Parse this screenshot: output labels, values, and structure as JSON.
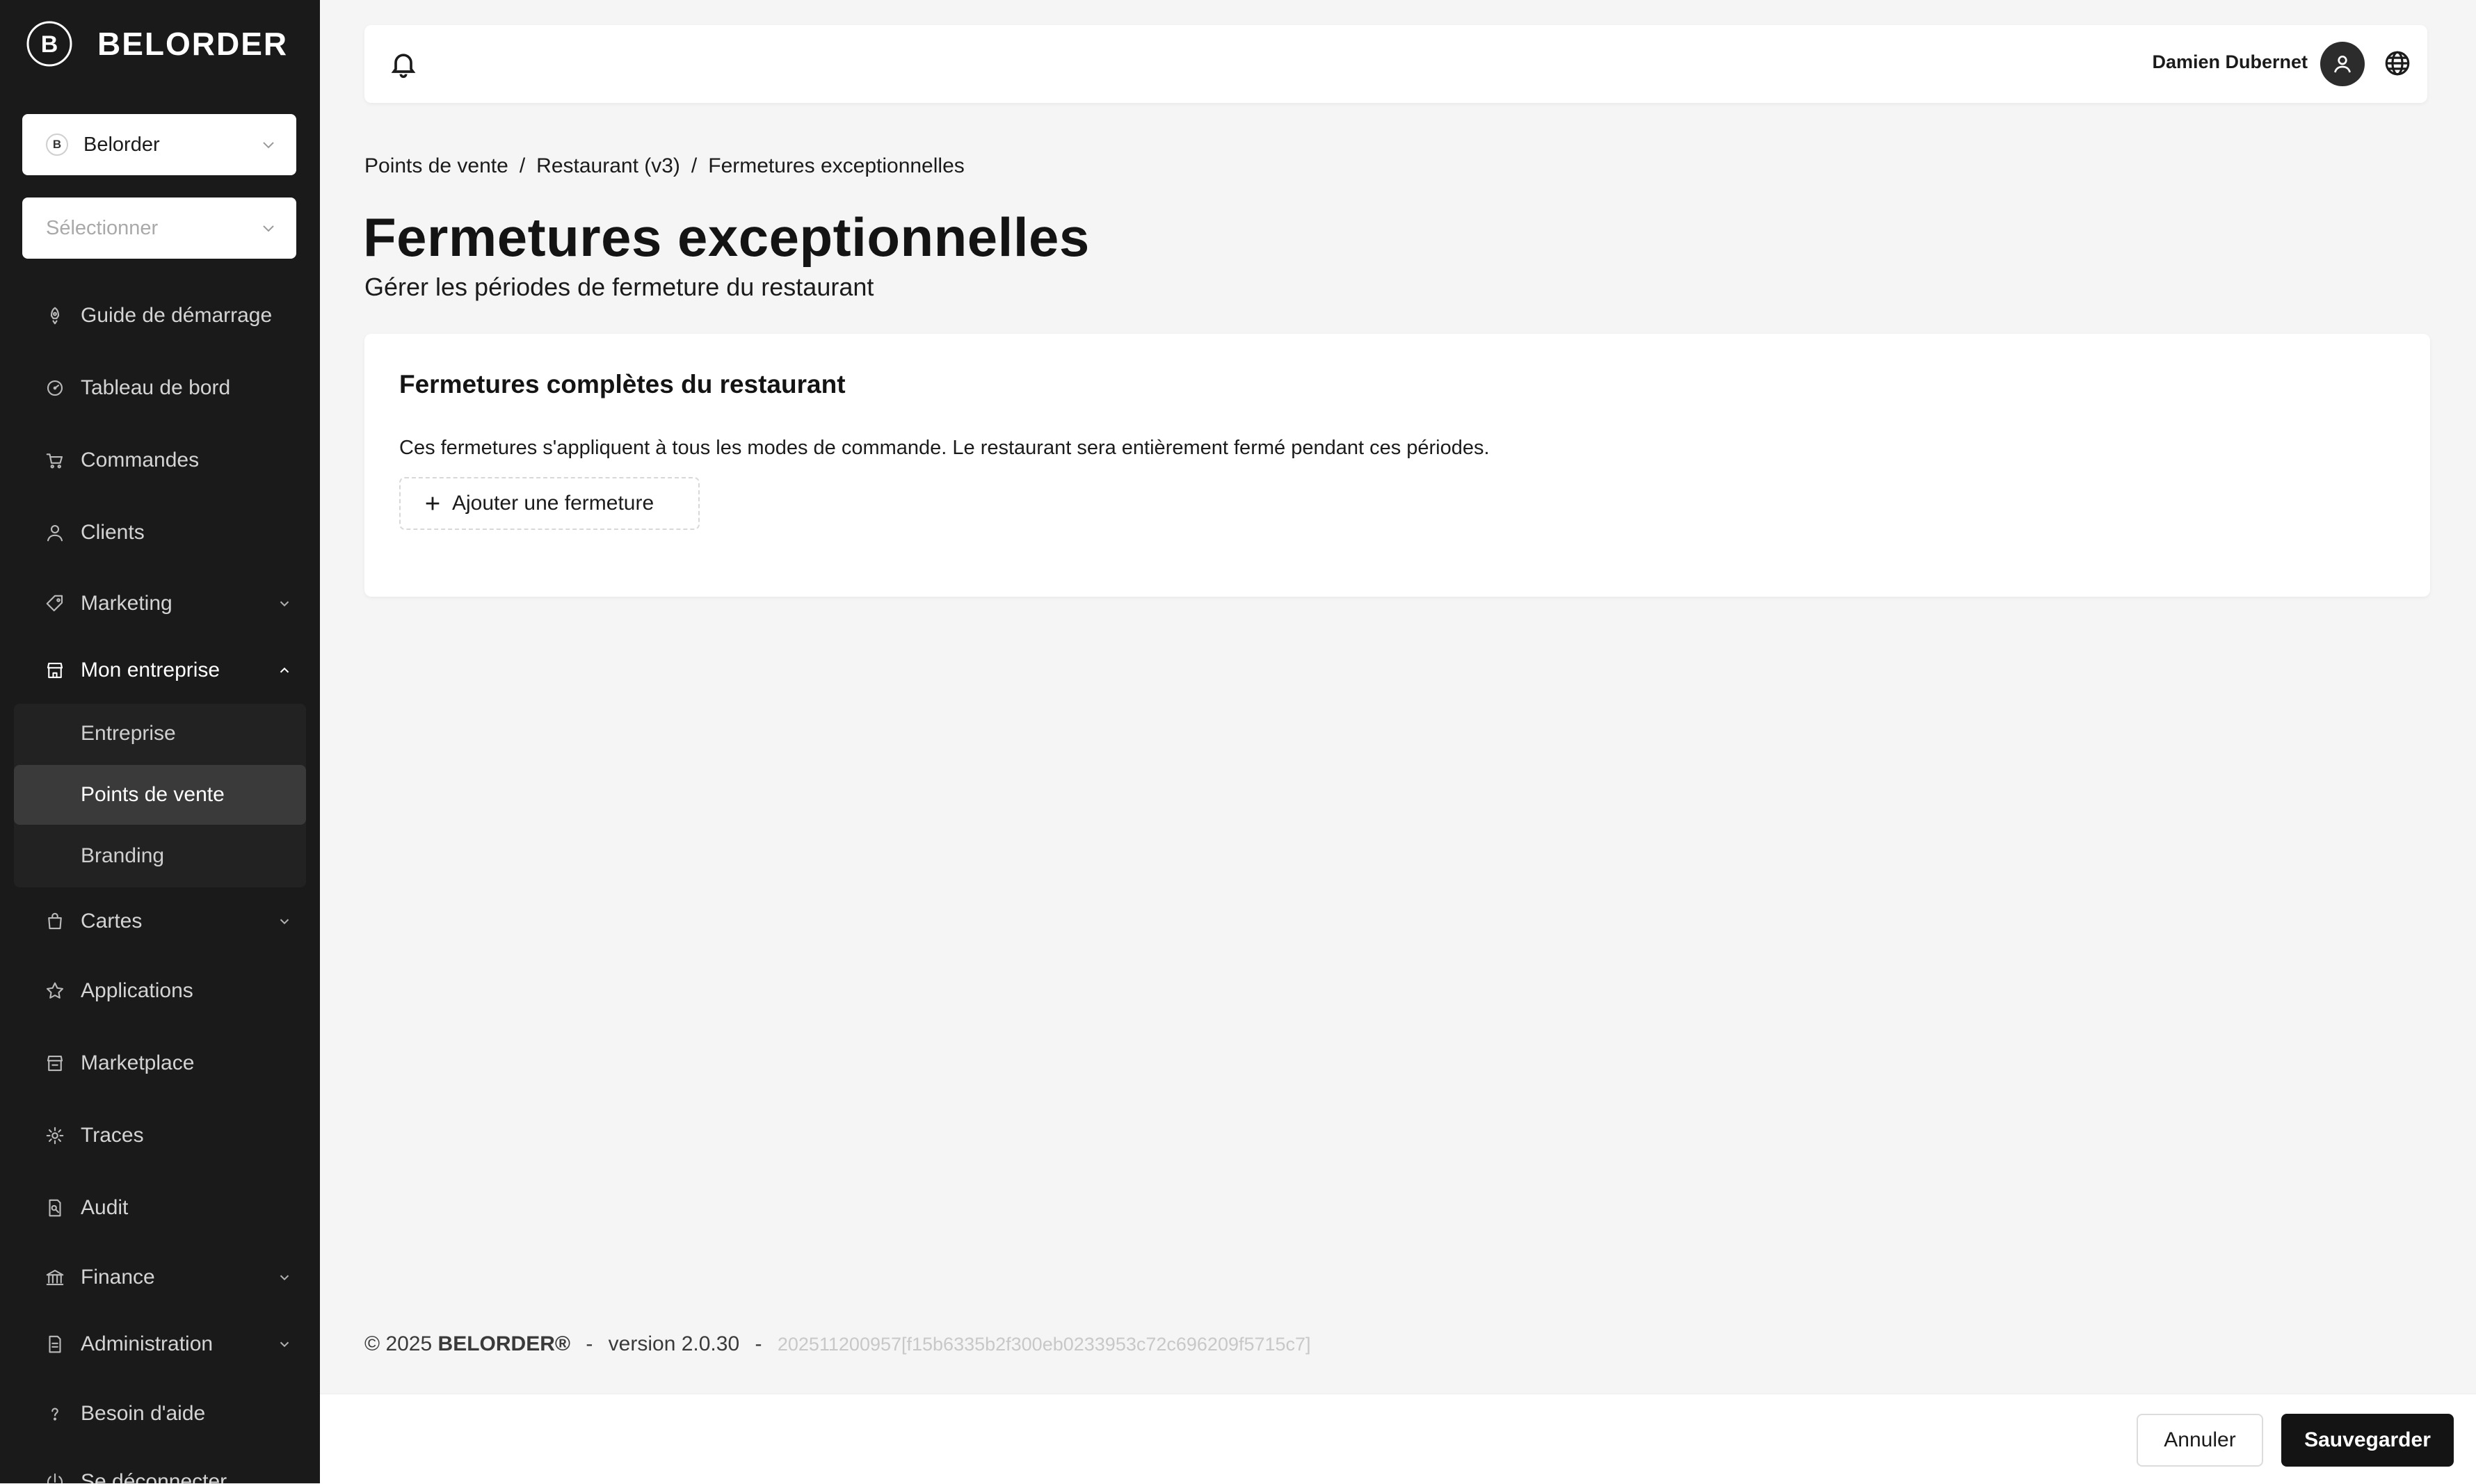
{
  "app": {
    "logo_text": "BELORDER",
    "logo_mark": "B"
  },
  "sidebar": {
    "org_select": {
      "value": "Belorder",
      "badge": "B"
    },
    "site_select": {
      "placeholder": "Sélectionner"
    },
    "items": [
      {
        "label": "Guide de démarrage",
        "icon": "rocket-icon"
      },
      {
        "label": "Tableau de bord",
        "icon": "dashboard-icon"
      },
      {
        "label": "Commandes",
        "icon": "cart-icon"
      },
      {
        "label": "Clients",
        "icon": "user-icon"
      },
      {
        "label": "Marketing",
        "icon": "tag-icon",
        "expandable": true
      },
      {
        "label": "Mon entreprise",
        "icon": "store-icon",
        "expanded": true
      },
      {
        "label": "Cartes",
        "icon": "bag-icon",
        "expandable": true
      },
      {
        "label": "Applications",
        "icon": "star-icon"
      },
      {
        "label": "Marketplace",
        "icon": "shop-icon"
      },
      {
        "label": "Traces",
        "icon": "gear-icon"
      },
      {
        "label": "Audit",
        "icon": "audit-icon"
      },
      {
        "label": "Finance",
        "icon": "bank-icon",
        "expandable": true
      },
      {
        "label": "Administration",
        "icon": "document-icon",
        "expandable": true
      },
      {
        "label": "Besoin d'aide",
        "icon": "help-icon"
      },
      {
        "label": "Se déconnecter",
        "icon": "power-icon"
      }
    ],
    "subitems": [
      {
        "label": "Entreprise"
      },
      {
        "label": "Points de vente",
        "selected": true
      },
      {
        "label": "Branding"
      }
    ]
  },
  "topbar": {
    "user_name": "Damien Dubernet"
  },
  "breadcrumb": [
    "Points de vente",
    "Restaurant (v3)",
    "Fermetures exceptionnelles"
  ],
  "breadcrumb_separator": "/",
  "page": {
    "title": "Fermetures exceptionnelles",
    "subtitle": "Gérer les périodes de fermeture du restaurant"
  },
  "card": {
    "title": "Fermetures complètes du restaurant",
    "description": "Ces fermetures s'appliquent à tous les modes de commande. Le restaurant sera entièrement fermé pendant ces périodes.",
    "add_button": "Ajouter une fermeture"
  },
  "footer": {
    "copyright": "© 2025",
    "brand": "BELORDER®",
    "separator": "-",
    "version": "version 2.0.30",
    "build": "202511200957[f15b6335b2f300eb0233953c72c696209f5715c7]"
  },
  "actions": {
    "cancel": "Annuler",
    "save": "Sauvegarder"
  },
  "colors": {
    "sidebar_bg": "#1a1a1a",
    "page_bg": "#f5f5f5",
    "primary_button": "#141414",
    "selected_nav": "#3a3a3a"
  }
}
